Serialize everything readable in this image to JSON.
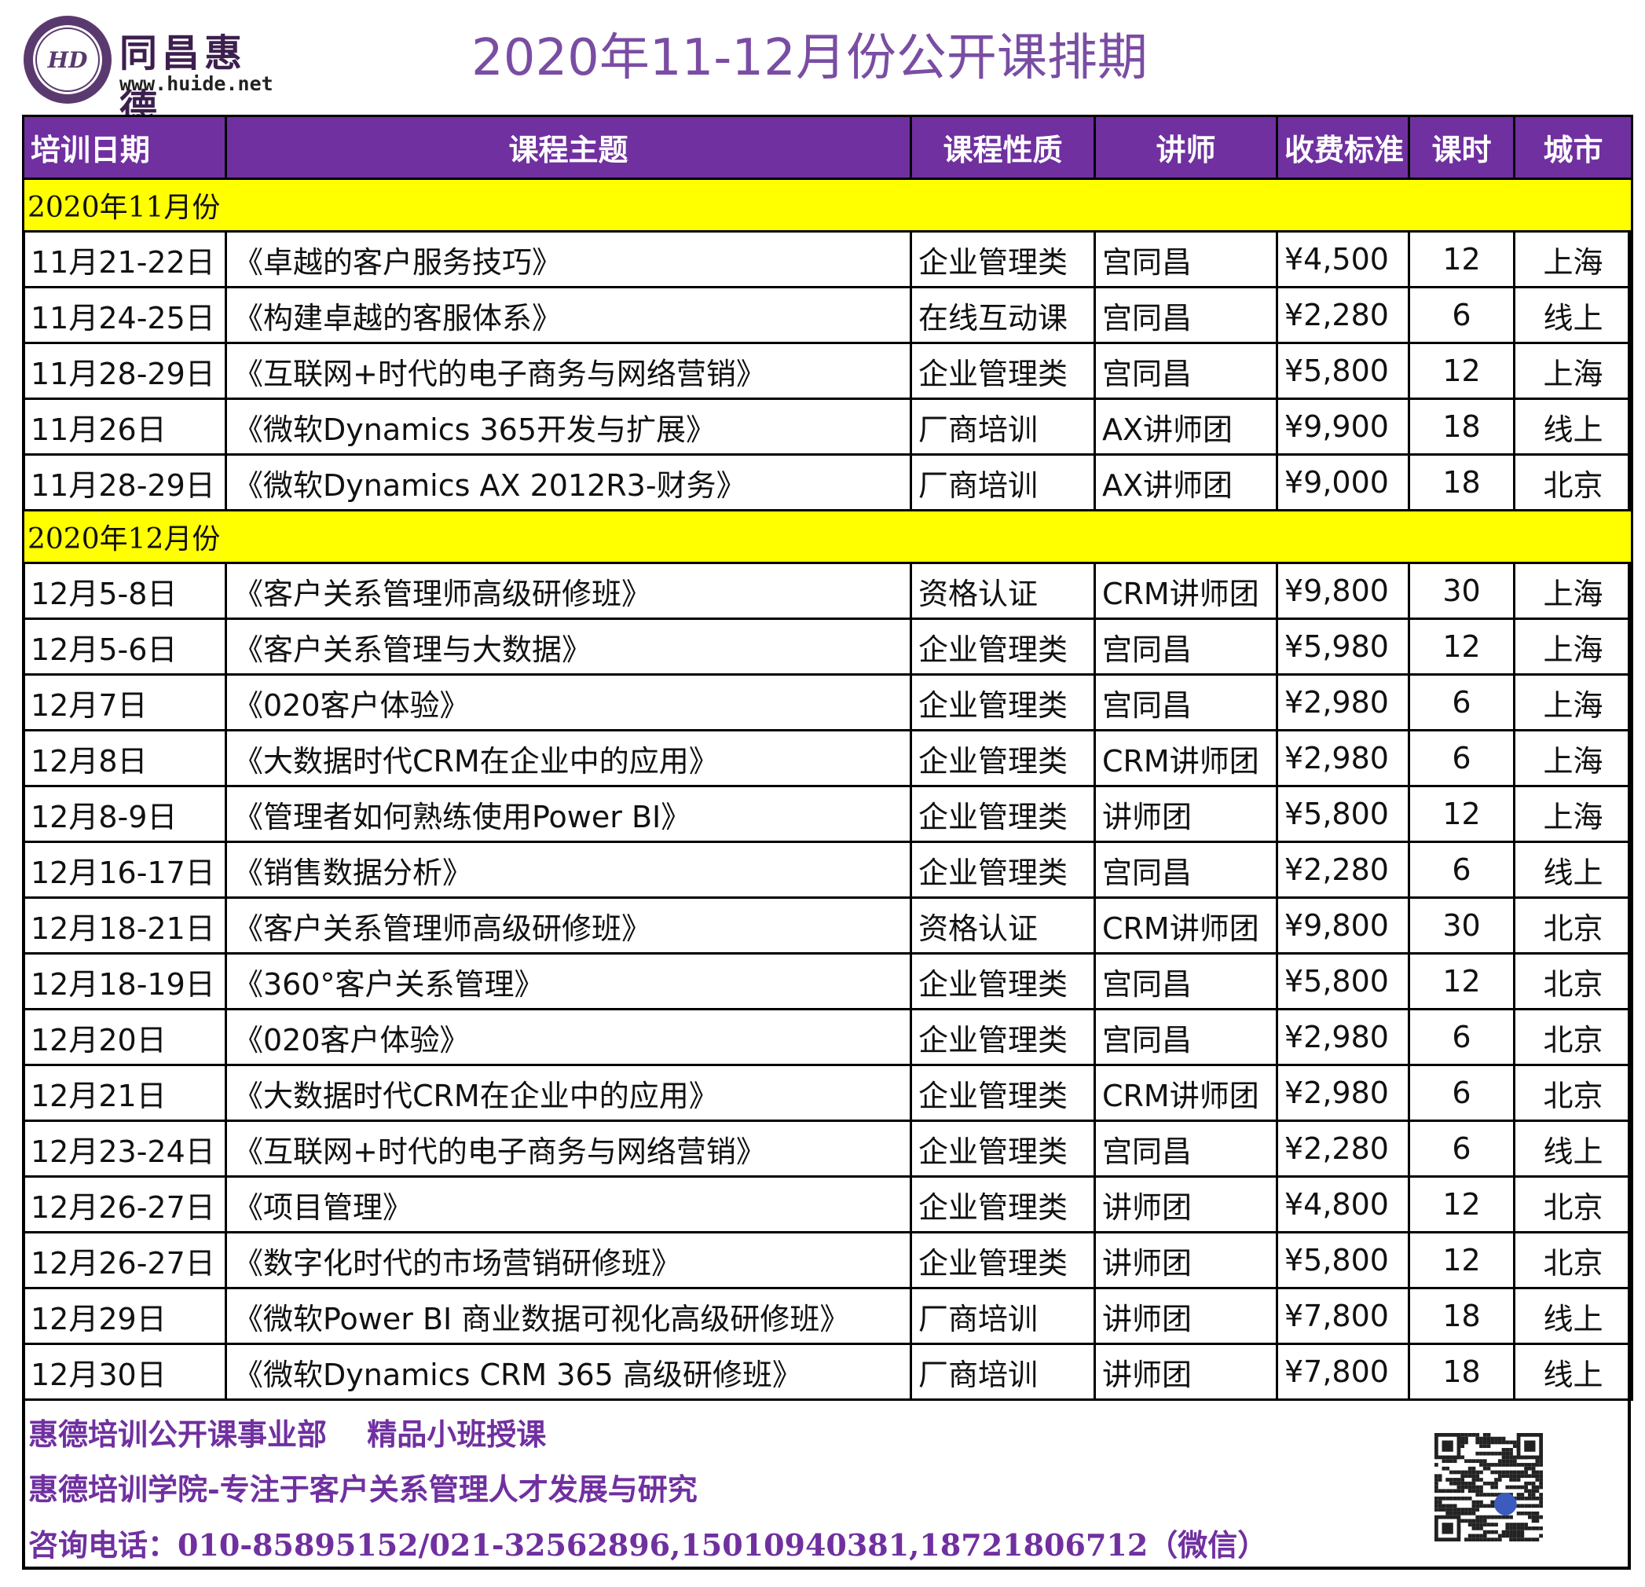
{
  "logo": {
    "name_cn": "同昌惠德",
    "url": "www.huide.net",
    "seal_initials": "HD"
  },
  "title": "2020年11-12月份公开课排期",
  "table": {
    "headers": [
      "培训日期",
      "课程主题",
      "课程性质",
      "讲师",
      "收费标准",
      "课时",
      "城市"
    ],
    "sections": [
      {
        "label": "2020年11月份",
        "rows": [
          {
            "date": "11月21-22日",
            "topic": "《卓越的客户服务技巧》",
            "type": "企业管理类",
            "teacher": "宫同昌",
            "fee": "¥4,500",
            "hours": "12",
            "city": "上海"
          },
          {
            "date": "11月24-25日",
            "topic": "《构建卓越的客服体系》",
            "type": "在线互动课",
            "teacher": "宫同昌",
            "fee": "¥2,280",
            "hours": "6",
            "city": "线上"
          },
          {
            "date": "11月28-29日",
            "topic": "《互联网+时代的电子商务与网络营销》",
            "type": "企业管理类",
            "teacher": "宫同昌",
            "fee": "¥5,800",
            "hours": "12",
            "city": "上海"
          },
          {
            "date": "11月26日",
            "topic": "《微软Dynamics 365开发与扩展》",
            "type": "厂商培训",
            "teacher": "AX讲师团",
            "fee": "¥9,900",
            "hours": "18",
            "city": "线上"
          },
          {
            "date": "11月28-29日",
            "topic": "《微软Dynamics AX 2012R3-财务》",
            "type": "厂商培训",
            "teacher": "AX讲师团",
            "fee": "¥9,000",
            "hours": "18",
            "city": "北京"
          }
        ]
      },
      {
        "label": "2020年12月份",
        "rows": [
          {
            "date": "12月5-8日",
            "topic": "《客户关系管理师高级研修班》",
            "type": "资格认证",
            "teacher": "CRM讲师团",
            "fee": "¥9,800",
            "hours": "30",
            "city": "上海"
          },
          {
            "date": "12月5-6日",
            "topic": "《客户关系管理与大数据》",
            "type": "企业管理类",
            "teacher": "宫同昌",
            "fee": "¥5,980",
            "hours": "12",
            "city": "上海"
          },
          {
            "date": "12月7日",
            "topic": "《020客户体验》",
            "type": "企业管理类",
            "teacher": "宫同昌",
            "fee": "¥2,980",
            "hours": "6",
            "city": "上海"
          },
          {
            "date": "12月8日",
            "topic": "《大数据时代CRM在企业中的应用》",
            "type": "企业管理类",
            "teacher": "CRM讲师团",
            "fee": "¥2,980",
            "hours": "6",
            "city": "上海"
          },
          {
            "date": "12月8-9日",
            "topic": "《管理者如何熟练使用Power BI》",
            "type": "企业管理类",
            "teacher": "讲师团",
            "fee": "¥5,800",
            "hours": "12",
            "city": "上海"
          },
          {
            "date": "12月16-17日",
            "topic": "《销售数据分析》",
            "type": "企业管理类",
            "teacher": "宫同昌",
            "fee": "¥2,280",
            "hours": "6",
            "city": "线上"
          },
          {
            "date": "12月18-21日",
            "topic": "《客户关系管理师高级研修班》",
            "type": "资格认证",
            "teacher": "CRM讲师团",
            "fee": "¥9,800",
            "hours": "30",
            "city": "北京"
          },
          {
            "date": "12月18-19日",
            "topic": "《360°客户关系管理》",
            "type": "企业管理类",
            "teacher": "宫同昌",
            "fee": "¥5,800",
            "hours": "12",
            "city": "北京"
          },
          {
            "date": "12月20日",
            "topic": "《020客户体验》",
            "type": "企业管理类",
            "teacher": "宫同昌",
            "fee": "¥2,980",
            "hours": "6",
            "city": "北京"
          },
          {
            "date": "12月21日",
            "topic": "《大数据时代CRM在企业中的应用》",
            "type": "企业管理类",
            "teacher": "CRM讲师团",
            "fee": "¥2,980",
            "hours": "6",
            "city": "北京"
          },
          {
            "date": "12月23-24日",
            "topic": "《互联网+时代的电子商务与网络营销》",
            "type": "企业管理类",
            "teacher": "宫同昌",
            "fee": "¥2,280",
            "hours": "6",
            "city": "线上"
          },
          {
            "date": "12月26-27日",
            "topic": "《项目管理》",
            "type": "企业管理类",
            "teacher": "讲师团",
            "fee": "¥4,800",
            "hours": "12",
            "city": "北京"
          },
          {
            "date": "12月26-27日",
            "topic": "《数字化时代的市场营销研修班》",
            "type": "企业管理类",
            "teacher": "讲师团",
            "fee": "¥5,800",
            "hours": "12",
            "city": "北京"
          },
          {
            "date": "12月29日",
            "topic": "《微软Power BI 商业数据可视化高级研修班》",
            "type": "厂商培训",
            "teacher": "讲师团",
            "fee": "¥7,800",
            "hours": "18",
            "city": "线上"
          },
          {
            "date": "12月30日",
            "topic": "《微软Dynamics CRM 365 高级研修班》",
            "type": "厂商培训",
            "teacher": "讲师团",
            "fee": "¥7,800",
            "hours": "18",
            "city": "线上"
          }
        ]
      }
    ]
  },
  "footer": {
    "line1": "惠德培训公开课事业部　 精品小班授课",
    "line2": "惠德培训学院-专注于客户关系管理人才发展与研究",
    "line3": "咨询电话：010-85895152/021-32562896,15010940381,18721806712（微信）"
  },
  "colors": {
    "header_bg": "#7030a0",
    "month_bg": "#ffff00",
    "title": "#7a4da3",
    "footer_text": "#7030a0"
  },
  "icons": [
    "logo-seal-icon",
    "qr-code-icon"
  ]
}
